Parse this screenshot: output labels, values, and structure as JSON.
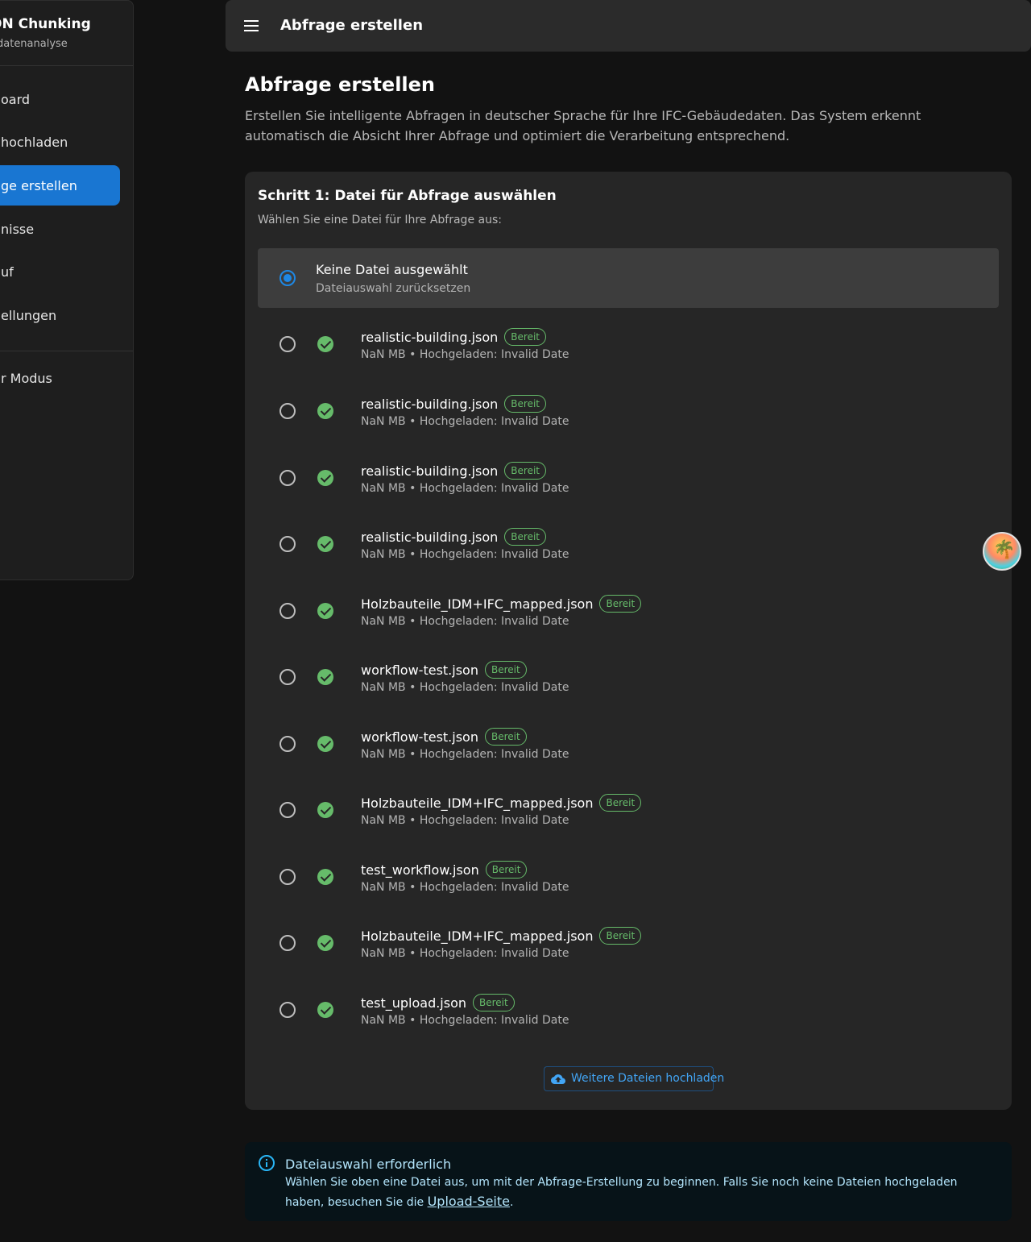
{
  "sidebar": {
    "title": "ON Chunking",
    "subtitle": "edatenanalyse",
    "items": [
      {
        "label": "oard"
      },
      {
        "label": "hochladen"
      },
      {
        "label": "ge erstellen",
        "active": true
      },
      {
        "label": "nisse"
      },
      {
        "label": "uf"
      },
      {
        "label": "ellungen"
      }
    ],
    "mode_label": "r Modus"
  },
  "topbar": {
    "menu_icon": "menu-icon",
    "title": "Abfrage erstellen"
  },
  "page": {
    "title": "Abfrage erstellen",
    "description": "Erstellen Sie intelligente Abfragen in deutscher Sprache für Ihre IFC-Gebäudedaten. Das System erkennt automatisch die Absicht Ihrer Abfrage und optimiert die Verarbeitung entsprechend."
  },
  "step1": {
    "title": "Schritt 1: Datei für Abfrage auswählen",
    "subtitle": "Wählen Sie eine Datei für Ihre Abfrage aus:",
    "none_option": {
      "label": "Keine Datei ausgewählt",
      "sub": "Dateiauswahl zurücksetzen",
      "selected": true
    },
    "files": [
      {
        "name": "realistic-building.json",
        "status": "Bereit",
        "meta": "NaN MB • Hochgeladen: Invalid Date"
      },
      {
        "name": "realistic-building.json",
        "status": "Bereit",
        "meta": "NaN MB • Hochgeladen: Invalid Date"
      },
      {
        "name": "realistic-building.json",
        "status": "Bereit",
        "meta": "NaN MB • Hochgeladen: Invalid Date"
      },
      {
        "name": "realistic-building.json",
        "status": "Bereit",
        "meta": "NaN MB • Hochgeladen: Invalid Date"
      },
      {
        "name": "Holzbauteile_IDM+IFC_mapped.json",
        "status": "Bereit",
        "meta": "NaN MB • Hochgeladen: Invalid Date"
      },
      {
        "name": "workflow-test.json",
        "status": "Bereit",
        "meta": "NaN MB • Hochgeladen: Invalid Date"
      },
      {
        "name": "workflow-test.json",
        "status": "Bereit",
        "meta": "NaN MB • Hochgeladen: Invalid Date"
      },
      {
        "name": "Holzbauteile_IDM+IFC_mapped.json",
        "status": "Bereit",
        "meta": "NaN MB • Hochgeladen: Invalid Date"
      },
      {
        "name": "test_workflow.json",
        "status": "Bereit",
        "meta": "NaN MB • Hochgeladen: Invalid Date"
      },
      {
        "name": "Holzbauteile_IDM+IFC_mapped.json",
        "status": "Bereit",
        "meta": "NaN MB • Hochgeladen: Invalid Date"
      },
      {
        "name": "test_upload.json",
        "status": "Bereit",
        "meta": "NaN MB • Hochgeladen: Invalid Date"
      }
    ],
    "upload_button": "Weitere Dateien hochladen"
  },
  "alert": {
    "title": "Dateiauswahl erforderlich",
    "text": "Wählen Sie oben eine Datei aus, um mit der Abfrage-Erstellung zu beginnen. Falls Sie noch keine Dateien hochgeladen haben, besuchen Sie die",
    "link": "Upload-Seite",
    "suffix": "."
  },
  "colors": {
    "accent": "#1976d2",
    "success": "#66bb6a",
    "info": "#29b6f6",
    "background": "#121212",
    "surface": "#262626"
  }
}
